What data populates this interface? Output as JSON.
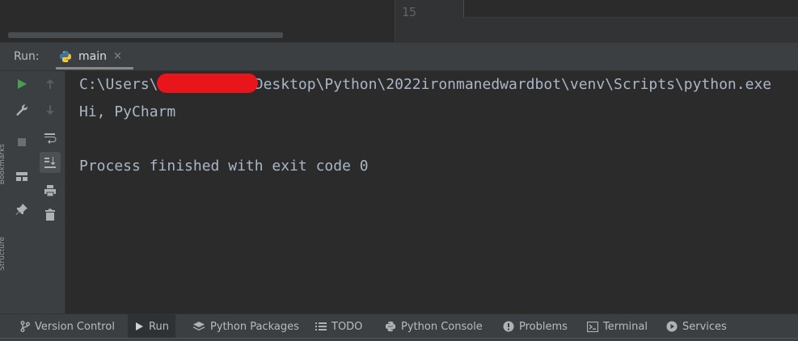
{
  "editor": {
    "line_number": "15"
  },
  "run_window": {
    "label": "Run:",
    "tab_label": "main",
    "tab_close": "×"
  },
  "side_strip": {
    "upper_label": "Bookmarks",
    "lower_label": "Structure"
  },
  "console": {
    "lines": [
      "C:\\Users\\          \\Desktop\\Python\\2022ironmanedwardbot\\venv\\Scripts\\python.exe",
      "Hi, PyCharm",
      "",
      "Process finished with exit code 0"
    ]
  },
  "bottom_bar": {
    "items": [
      {
        "label": "Version Control",
        "icon": "branch-icon"
      },
      {
        "label": "Run",
        "icon": "play-icon"
      },
      {
        "label": "Python Packages",
        "icon": "layers-icon"
      },
      {
        "label": "TODO",
        "icon": "list-icon"
      },
      {
        "label": "Python Console",
        "icon": "python-icon"
      },
      {
        "label": "Problems",
        "icon": "info-icon"
      },
      {
        "label": "Terminal",
        "icon": "terminal-icon"
      },
      {
        "label": "Services",
        "icon": "services-icon"
      }
    ]
  },
  "colors": {
    "background": "#2b2b2b",
    "panel": "#3c3f41",
    "console_text": "#a9b7c6",
    "run_green": "#499c54",
    "redaction": "#e8161b"
  }
}
